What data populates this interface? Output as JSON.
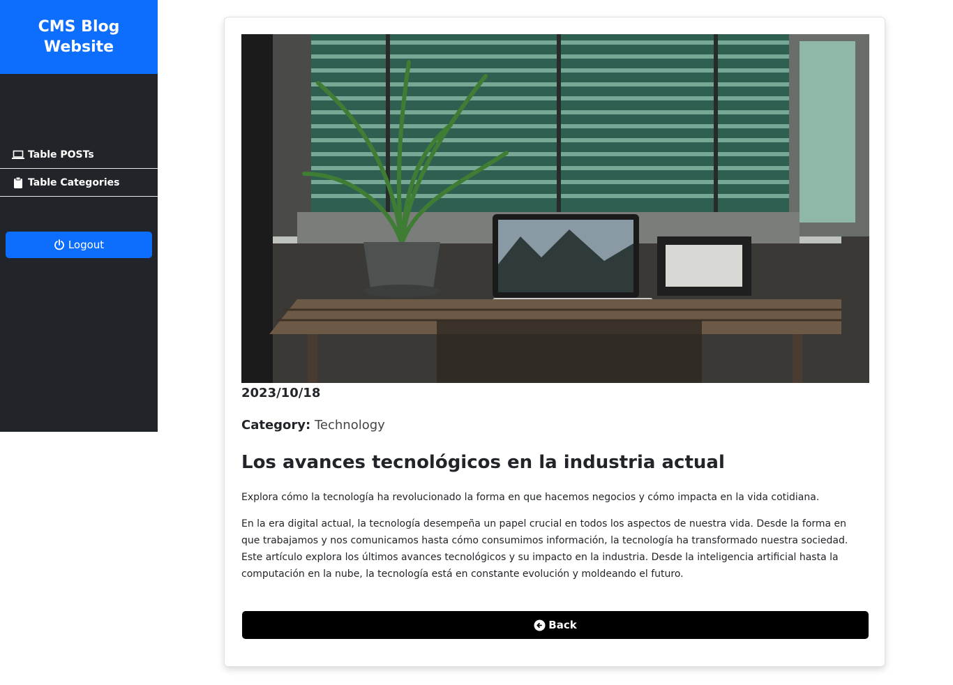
{
  "sidebar": {
    "brand": "CMS Blog Website",
    "items": [
      {
        "label": "Table POSTs",
        "icon": "laptop-icon"
      },
      {
        "label": "Table Categories",
        "icon": "clipboard-icon"
      }
    ],
    "logout_label": "Logout",
    "colors": {
      "brand_bg": "#0d6efd",
      "sidebar_bg": "#212529"
    }
  },
  "post": {
    "image_alt": "Laptop on wooden desk by window",
    "date": "2023/10/18",
    "category_label": "Category:",
    "category_value": "Technology",
    "title": "Los avances tecnológicos en la industria actual",
    "summary": "Explora cómo la tecnología ha revolucionado la forma en que hacemos negocios y cómo impacta en la vida cotidiana.",
    "content": "En la era digital actual, la tecnología desempeña un papel crucial en todos los aspectos de nuestra vida. Desde la forma en que trabajamos y nos comunicamos hasta cómo consumimos información, la tecnología ha transformado nuestra sociedad. Este artículo explora los últimos avances tecnológicos y su impacto en la industria. Desde la inteligencia artificial hasta la computación en la nube, la tecnología está en constante evolución y moldeando el futuro."
  },
  "back_label": "Back"
}
